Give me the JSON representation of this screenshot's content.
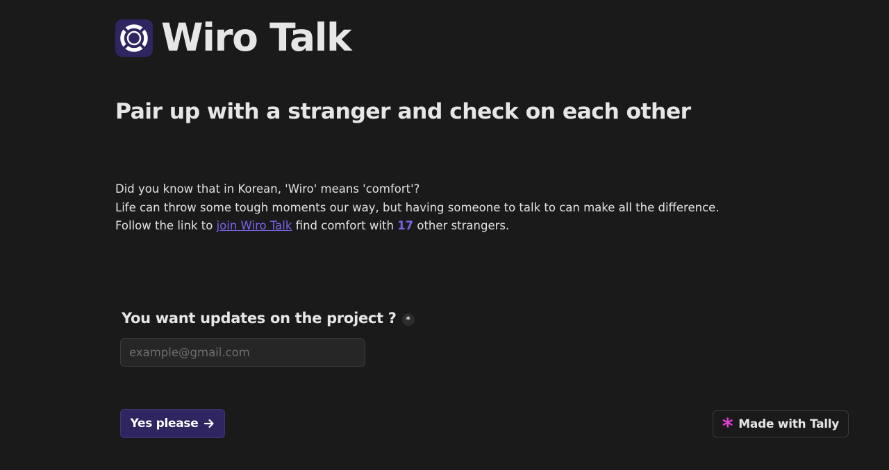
{
  "brand": {
    "title": "Wiro Talk",
    "logo_icon": "lifebuoy-icon",
    "logo_bg": "#2e2561"
  },
  "headline": "Pair up with a stranger and check on each other",
  "intro": {
    "line1": "Did you know that in Korean, 'Wiro' means 'comfort'?",
    "line2": "Life can throw some tough moments our way, but having someone to talk to can make all the difference.",
    "line3_before": "Follow the link to ",
    "link_text": "join Wiro Talk",
    "line3_middle": " find comfort with ",
    "count": "17",
    "line3_after": " other strangers."
  },
  "question": {
    "label": "You want updates on the project ?",
    "required_mark": "*"
  },
  "email_field": {
    "placeholder": "example@gmail.com",
    "value": ""
  },
  "submit": {
    "label": "Yes please",
    "icon": "arrow-right-icon"
  },
  "badge": {
    "label": "Made with Tally",
    "icon": "tally-asterisk-icon",
    "icon_glyph": "*"
  },
  "colors": {
    "background": "#1b1a1b",
    "accent": "#7b63e8",
    "button_bg": "#2e2561",
    "tally_pink": "#e33fd7"
  }
}
